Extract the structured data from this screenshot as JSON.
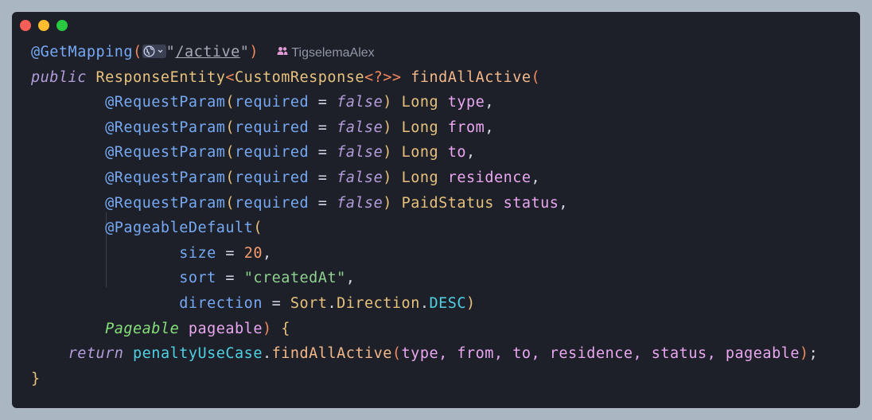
{
  "window": {
    "controls": {
      "close_color": "#ff5f57",
      "minimize_color": "#febc2e",
      "maximize_color": "#28c840"
    }
  },
  "code": {
    "line1": {
      "annotation": "@GetMapping",
      "open": "(",
      "quote_open": "\"",
      "url": "/active",
      "quote_close": "\"",
      "close": ")",
      "author_icon": "users-icon",
      "author": "TigselemaAlex"
    },
    "line2": {
      "keyword": "public",
      "return_type": "ResponseEntity",
      "generic_open": "<",
      "generic_type": "CustomResponse",
      "generic_rest": "<?>>",
      "method": "findAllActive",
      "open": "("
    },
    "params": [
      {
        "annotation": "@RequestParam",
        "open": "(",
        "attr": "required",
        "eq": " = ",
        "value": "false",
        "close": ")",
        "type": "Long",
        "name": "type",
        "sep": ","
      },
      {
        "annotation": "@RequestParam",
        "open": "(",
        "attr": "required",
        "eq": " = ",
        "value": "false",
        "close": ")",
        "type": "Long",
        "name": "from",
        "sep": ","
      },
      {
        "annotation": "@RequestParam",
        "open": "(",
        "attr": "required",
        "eq": " = ",
        "value": "false",
        "close": ")",
        "type": "Long",
        "name": "to",
        "sep": ","
      },
      {
        "annotation": "@RequestParam",
        "open": "(",
        "attr": "required",
        "eq": " = ",
        "value": "false",
        "close": ")",
        "type": "Long",
        "name": "residence",
        "sep": ","
      },
      {
        "annotation": "@RequestParam",
        "open": "(",
        "attr": "required",
        "eq": " = ",
        "value": "false",
        "close": ")",
        "type": "PaidStatus",
        "name": "status",
        "sep": ","
      }
    ],
    "pageable_default": {
      "annotation": "@PageableDefault",
      "open": "(",
      "size_attr": "size",
      "size_eq": " = ",
      "size_value": "20",
      "size_sep": ",",
      "sort_attr": "sort",
      "sort_eq": " = ",
      "sort_value": "\"createdAt\"",
      "sort_sep": ",",
      "direction_attr": "direction",
      "direction_eq": " = ",
      "direction_class": "Sort",
      "dot1": ".",
      "direction_enum": "Direction",
      "dot2": ".",
      "direction_value": "DESC",
      "close": ")"
    },
    "pageable_param": {
      "type": "Pageable",
      "name": "pageable",
      "close": ")",
      "brace": "{"
    },
    "return_stmt": {
      "keyword": "return",
      "object": "penaltyUseCase",
      "dot": ".",
      "method": "findAllActive",
      "open": "(",
      "args": "type, from, to, residence, status, pageable",
      "close": ")",
      "semi": ";"
    },
    "closing_brace": "}"
  }
}
